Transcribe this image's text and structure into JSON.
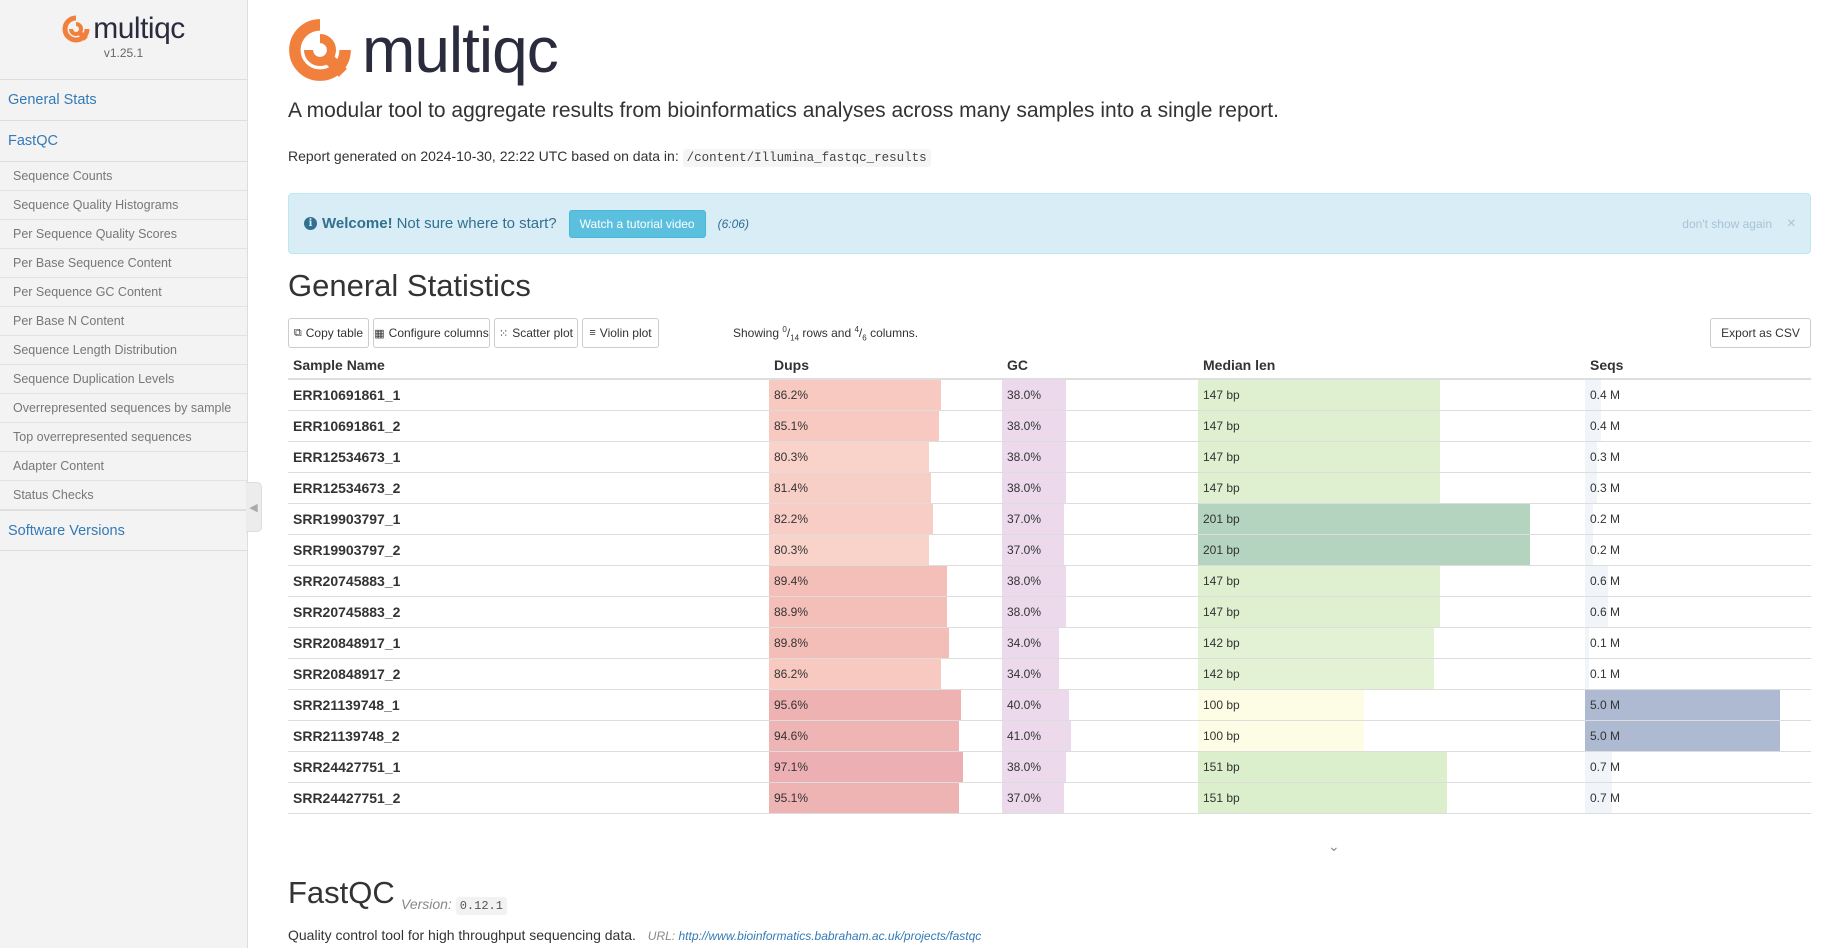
{
  "sidebar": {
    "logo_text": "multiqc",
    "version": "v1.25.1",
    "general_stats": "General Stats",
    "fastqc": "FastQC",
    "fastqc_items": [
      "Sequence Counts",
      "Sequence Quality Histograms",
      "Per Sequence Quality Scores",
      "Per Base Sequence Content",
      "Per Sequence GC Content",
      "Per Base N Content",
      "Sequence Length Distribution",
      "Sequence Duplication Levels",
      "Overrepresented sequences by sample",
      "Top overrepresented sequences",
      "Adapter Content",
      "Status Checks"
    ],
    "software_versions": "Software Versions"
  },
  "header": {
    "logo_text": "multiqc",
    "tagline": "A modular tool to aggregate results from bioinformatics analyses across many samples into a single report.",
    "report_prefix": "Report generated on 2024-10-30, 22:22 UTC based on data in:",
    "data_path": "/content/Illumina_fastqc_results"
  },
  "welcome": {
    "bold": "Welcome!",
    "text": "Not sure where to start?",
    "button": "Watch a tutorial video",
    "duration": "(6:06)",
    "dont_show": "don't show again",
    "close": "×"
  },
  "general_stats": {
    "title": "General Statistics",
    "toolbar": {
      "copy": "Copy table",
      "configure": "Configure columns",
      "scatter": "Scatter plot",
      "violin": "Violin plot",
      "showing_prefix": "Showing",
      "rows_shown": "0",
      "rows_total": "14",
      "rows_label": "rows and",
      "cols_shown": "4",
      "cols_total": "6",
      "cols_label": "columns.",
      "export": "Export as CSV"
    },
    "columns": {
      "name": "Sample Name",
      "dups": "Dups",
      "gc": "GC",
      "len": "Median len",
      "seqs": "Seqs"
    },
    "rows": [
      {
        "name": "ERR10691861_1",
        "dups": "86.2%",
        "gc": "38.0%",
        "len": "147 bp",
        "seqs": "0.4 M"
      },
      {
        "name": "ERR10691861_2",
        "dups": "85.1%",
        "gc": "38.0%",
        "len": "147 bp",
        "seqs": "0.4 M"
      },
      {
        "name": "ERR12534673_1",
        "dups": "80.3%",
        "gc": "38.0%",
        "len": "147 bp",
        "seqs": "0.3 M"
      },
      {
        "name": "ERR12534673_2",
        "dups": "81.4%",
        "gc": "38.0%",
        "len": "147 bp",
        "seqs": "0.3 M"
      },
      {
        "name": "SRR19903797_1",
        "dups": "82.2%",
        "gc": "37.0%",
        "len": "201 bp",
        "seqs": "0.2 M"
      },
      {
        "name": "SRR19903797_2",
        "dups": "80.3%",
        "gc": "37.0%",
        "len": "201 bp",
        "seqs": "0.2 M"
      },
      {
        "name": "SRR20745883_1",
        "dups": "89.4%",
        "gc": "38.0%",
        "len": "147 bp",
        "seqs": "0.6 M"
      },
      {
        "name": "SRR20745883_2",
        "dups": "88.9%",
        "gc": "38.0%",
        "len": "147 bp",
        "seqs": "0.6 M"
      },
      {
        "name": "SRR20848917_1",
        "dups": "89.8%",
        "gc": "34.0%",
        "len": "142 bp",
        "seqs": "0.1 M"
      },
      {
        "name": "SRR20848917_2",
        "dups": "86.2%",
        "gc": "34.0%",
        "len": "142 bp",
        "seqs": "0.1 M"
      },
      {
        "name": "SRR21139748_1",
        "dups": "95.6%",
        "gc": "40.0%",
        "len": "100 bp",
        "seqs": "5.0 M"
      },
      {
        "name": "SRR21139748_2",
        "dups": "94.6%",
        "gc": "41.0%",
        "len": "100 bp",
        "seqs": "5.0 M"
      },
      {
        "name": "SRR24427751_1",
        "dups": "97.1%",
        "gc": "38.0%",
        "len": "151 bp",
        "seqs": "0.7 M"
      },
      {
        "name": "SRR24427751_2",
        "dups": "95.1%",
        "gc": "37.0%",
        "len": "151 bp",
        "seqs": "0.7 M"
      }
    ],
    "bar_fractions": {
      "dups": [
        0.86,
        0.85,
        0.8,
        0.81,
        0.82,
        0.8,
        0.89,
        0.89,
        0.9,
        0.86,
        0.96,
        0.95,
        0.97,
        0.95
      ],
      "gc": [
        0.38,
        0.38,
        0.38,
        0.38,
        0.37,
        0.37,
        0.38,
        0.38,
        0.34,
        0.34,
        0.4,
        0.41,
        0.38,
        0.37
      ],
      "len": [
        0.73,
        0.73,
        0.73,
        0.73,
        1.0,
        1.0,
        0.73,
        0.73,
        0.71,
        0.71,
        0.5,
        0.5,
        0.75,
        0.75
      ],
      "seqs": [
        0.08,
        0.08,
        0.06,
        0.06,
        0.04,
        0.04,
        0.12,
        0.12,
        0.02,
        0.02,
        1.0,
        1.0,
        0.14,
        0.14
      ]
    },
    "bar_colors": {
      "dups": [
        "#f7c9c1",
        "#f7c9c1",
        "#f9d3ca",
        "#f8cfc6",
        "#f8cdc5",
        "#f9d3ca",
        "#f4bfb8",
        "#f4bfb8",
        "#f3beb7",
        "#f7c9c1",
        "#eeb2b2",
        "#efb4b4",
        "#ecafb3",
        "#eeb3b3"
      ],
      "gc": [
        "#ecdaec",
        "#ecdaec",
        "#ecdaec",
        "#ecdaec",
        "#ecdaec",
        "#ecdaec",
        "#ecdaec",
        "#ecdaec",
        "#ecdaec",
        "#ecdaec",
        "#ecdaec",
        "#ecdaec",
        "#ecdaec",
        "#ecdaec"
      ],
      "len": [
        "#dff0d0",
        "#dff0d0",
        "#dff0d0",
        "#dff0d0",
        "#b5d4bf",
        "#b5d4bf",
        "#dff0d0",
        "#dff0d0",
        "#e3f2d5",
        "#e3f2d5",
        "#fdfde6",
        "#fdfde6",
        "#dcefcd",
        "#dcefcd"
      ],
      "seqs": [
        "#f1f4f9",
        "#f1f4f9",
        "#f1f4f9",
        "#f1f4f9",
        "#f1f4f9",
        "#f1f4f9",
        "#f1f4f9",
        "#f1f4f9",
        "#f1f4f9",
        "#f1f4f9",
        "#aebad2",
        "#aebad2",
        "#f1f4f9",
        "#f1f4f9"
      ]
    }
  },
  "fastqc_section": {
    "title": "FastQC",
    "version_label": "Version:",
    "version": "0.12.1",
    "description": "Quality control tool for high throughput sequencing data.",
    "url_label": "URL:",
    "url": "http://www.bioinformatics.babraham.ac.uk/projects/fastqc"
  },
  "colors": {
    "accent": "#337ab7",
    "logo_orange": "#f0803b",
    "logo_dark": "#2b2b3e"
  }
}
